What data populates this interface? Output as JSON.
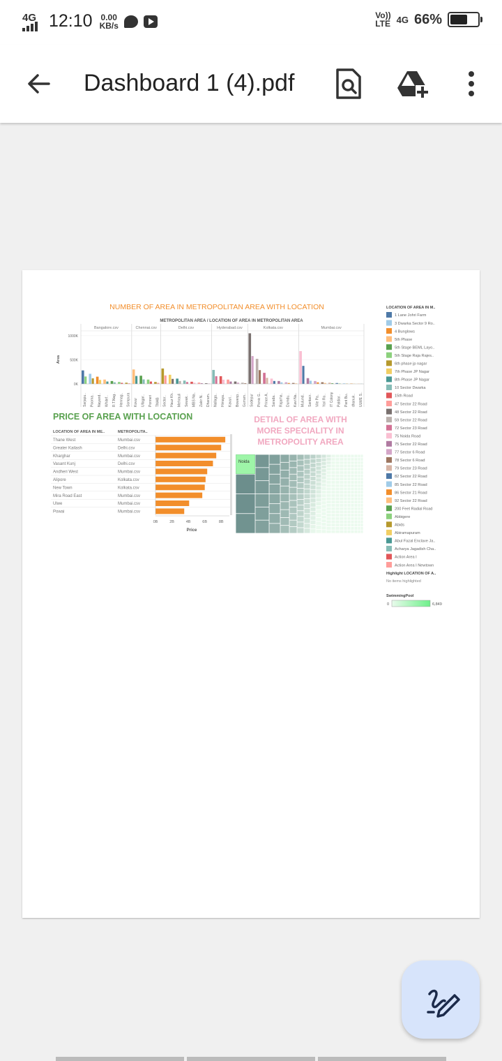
{
  "status_bar": {
    "network": "4G",
    "time": "12:10",
    "speed_value": "0.00",
    "speed_unit": "KB/s",
    "volte": "Vo))",
    "lte": "LTE",
    "right_network": "4G",
    "battery_percent": "66%",
    "battery_level": 0.66
  },
  "app_bar": {
    "title": "Dashboard 1 (4).pdf",
    "icons": [
      "back-arrow-icon",
      "search-document-icon",
      "drive-add-icon",
      "more-vert-icon"
    ]
  },
  "dashboard": {
    "title": "NUMBER OF AREA IN METROPOLITAN AREA WITH LOCATION",
    "chart_header": "METROPOLITAN AREA  /  LOCATION OF AREA IN METROPOLITAN AREA",
    "colors": {
      "orange": "#f28e2b",
      "green": "#59a14f",
      "pink": "#f1a8c0",
      "lightgreen": "#9ef5a8"
    },
    "price_title": "PRICE OF AREA WITH LOCATION",
    "detail_title": [
      "DETIAL OF AREA WITH",
      "MORE SPECIALITY IN",
      "METROPOLITY AREA"
    ],
    "treemap_label": "Noida",
    "legend_title": "LOCATION OF AREA IN M..",
    "highlight_title": "Highlight LOCATION OF A..",
    "highlight_text": "No items highlighted",
    "swimming_title": "SwimmingPool",
    "swimming_min": "0",
    "swimming_max": "6,849",
    "legend_items": [
      {
        "label": "1 Lane Johri Farm",
        "color": "#4e79a7"
      },
      {
        "label": "3 Dwarka Sector 9 Ro..",
        "color": "#a0cbe8"
      },
      {
        "label": "4 Bunglows",
        "color": "#f28e2b"
      },
      {
        "label": "5th Phase",
        "color": "#ffbe7d"
      },
      {
        "label": "5th Stage BEML Layo..",
        "color": "#59a14f"
      },
      {
        "label": "5th Stage Raja Rajes..",
        "color": "#8cd17d"
      },
      {
        "label": "6th phase jp nagar",
        "color": "#b6992d"
      },
      {
        "label": "7th Phase JP Nagar",
        "color": "#f1ce63"
      },
      {
        "label": "8th Phase JP Nagar",
        "color": "#499894"
      },
      {
        "label": "10 Sector Dwarka",
        "color": "#86bcb6"
      },
      {
        "label": "15th Road",
        "color": "#e15759"
      },
      {
        "label": "47 Sector 22 Road",
        "color": "#ff9d9a"
      },
      {
        "label": "48 Sector 22 Road",
        "color": "#79706e"
      },
      {
        "label": "59 Sector 22 Road",
        "color": "#bab0ac"
      },
      {
        "label": "72 Sector 23 Road",
        "color": "#d37295"
      },
      {
        "label": "75 Noida Road",
        "color": "#fabfd2"
      },
      {
        "label": "75 Sector 22 Road",
        "color": "#b07aa1"
      },
      {
        "label": "77 Sector 6 Road",
        "color": "#d4a6c8"
      },
      {
        "label": "78 Sector 6 Road",
        "color": "#9d7660"
      },
      {
        "label": "79 Sector 23 Road",
        "color": "#d7b5a6"
      },
      {
        "label": "82 Sector 22 Road",
        "color": "#4e79a7"
      },
      {
        "label": "85 Sector 22 Road",
        "color": "#a0cbe8"
      },
      {
        "label": "86 Sector 21 Road",
        "color": "#f28e2b"
      },
      {
        "label": "92 Sector 22 Road",
        "color": "#ffbe7d"
      },
      {
        "label": "200 Feet Radial Road",
        "color": "#59a14f"
      },
      {
        "label": "Abbigere",
        "color": "#8cd17d"
      },
      {
        "label": "Abids",
        "color": "#b6992d"
      },
      {
        "label": "Abiramapuram",
        "color": "#f1ce63"
      },
      {
        "label": "Abul Fazal Enclave Ja..",
        "color": "#499894"
      },
      {
        "label": "Acharya Jagadish Cha..",
        "color": "#86bcb6"
      },
      {
        "label": "Action Area I",
        "color": "#e15759"
      },
      {
        "label": "Action Area I Newtown",
        "color": "#ff9d9a"
      }
    ]
  },
  "chart_data": [
    {
      "type": "bar",
      "title": "NUMBER OF AREA IN METROPOLITAN AREA WITH LOCATION",
      "subtitle": "METROPOLITAN AREA  /  LOCATION OF AREA IN METROPOLITAN AREA",
      "ylabel": "Area",
      "yticks": [
        "0K",
        "500K",
        "1000K"
      ],
      "ylim": [
        0,
        1100000
      ],
      "grid": true,
      "panels": [
        {
          "name": "Bangalore.csv",
          "labels": [
            "Sarjapu..",
            "Poorna..",
            "Nayand..",
            "Whitef..",
            "R.T.Nag..",
            "Hennag..",
            "Sompura"
          ],
          "values": [
            280000,
            210000,
            150000,
            90000,
            60000,
            40000,
            25000
          ]
        },
        {
          "name": "Chennai.csv",
          "labels": [
            "Kovur",
            "Ullagar..",
            "Ponneri",
            "TNHB"
          ],
          "values": [
            300000,
            170000,
            90000,
            40000
          ]
        },
        {
          "name": "Delhi.csv",
          "labels": [
            "Sector..",
            "Hauz Kh..",
            "Mehrauli",
            "Sewak..",
            "MBS Na..",
            "Zakir N..",
            "Dharam.."
          ],
          "values": [
            320000,
            190000,
            110000,
            70000,
            45000,
            28000,
            15000
          ]
        },
        {
          "name": "Hyderabad.csv",
          "labels": [
            "Nallagа..",
            "Himaya..",
            "Kavuri..",
            "Bowenp..",
            "Gurram.."
          ],
          "values": [
            290000,
            160000,
            90000,
            50000,
            25000
          ]
        },
        {
          "name": "Kolkata.csv",
          "labels": [
            "Sodepur",
            "Picnic G..",
            "Prince A..",
            "Sarada..",
            "Rajarha..",
            "Dumdu..",
            "Kavi Na.."
          ],
          "values": [
            1050000,
            520000,
            230000,
            110000,
            60000,
            35000,
            20000
          ]
        },
        {
          "name": "Mumbai.csv",
          "labels": [
            "Mulund..",
            "Santacr..",
            "Vile Pa..",
            "Yari Ro..",
            "IT Colony",
            "Paldiar..",
            "Pant Bu..",
            "dhanuk..",
            "ULWE S.."
          ],
          "values": [
            680000,
            120000,
            60000,
            35000,
            25000,
            18000,
            12000,
            8000,
            5000
          ]
        }
      ]
    },
    {
      "type": "bar",
      "title": "PRICE OF AREA WITH LOCATION",
      "orientation": "horizontal",
      "xlabel": "Price",
      "columns": [
        "LOCATION OF AREA IN ME..",
        "METROPOLITA.."
      ],
      "xticks": [
        "0B",
        "2B",
        "4B",
        "6B",
        "8B"
      ],
      "xlim": [
        0,
        9000000000
      ],
      "rows": [
        {
          "location": "Thane West",
          "metro": "Mumbai.csv",
          "value": 8500000000
        },
        {
          "location": "Greater Kailash",
          "metro": "Delhi.csv",
          "value": 8000000000
        },
        {
          "location": "Kharghar",
          "metro": "Mumbai.csv",
          "value": 7400000000
        },
        {
          "location": "Vasant Kunj",
          "metro": "Delhi.csv",
          "value": 7000000000
        },
        {
          "location": "Andheri West",
          "metro": "Mumbai.csv",
          "value": 6300000000
        },
        {
          "location": "Alipore",
          "metro": "Kolkata.csv",
          "value": 6100000000
        },
        {
          "location": "New Town",
          "metro": "Kolkata.csv",
          "value": 6000000000
        },
        {
          "location": "Mira Road East",
          "metro": "Mumbai.csv",
          "value": 5700000000
        },
        {
          "location": "Ulwe",
          "metro": "Mumbai.csv",
          "value": 4100000000
        },
        {
          "location": "Powai",
          "metro": "Mumbai.csv",
          "value": 3500000000
        }
      ]
    }
  ]
}
